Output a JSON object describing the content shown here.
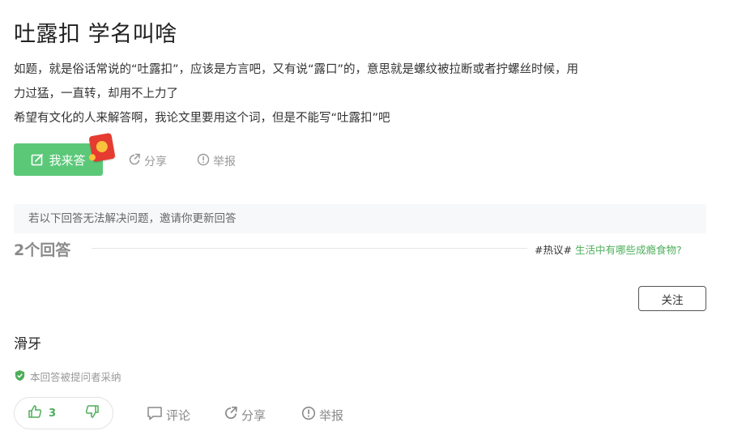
{
  "question": {
    "title": "吐露扣 学名叫啥",
    "description_lines": [
      "如题，就是俗话常说的“吐露扣”，应该是方言吧，又有说“露口”的，意思就是螺纹被拉断或者拧螺丝时候，用",
      "力过猛，一直转，却用不上力了",
      "希望有文化的人来解答啊，我论文里要用这个词，但是不能写“吐露扣”吧"
    ]
  },
  "actions": {
    "answer_label": "我来答",
    "share_label": "分享",
    "report_label": "举报"
  },
  "notice": "若以下回答无法解决问题，邀请你更新回答",
  "answers_header": {
    "count_label": "2个回答",
    "hot_tag": "#热议#",
    "hot_link": "生活中有哪些成瘾食物?"
  },
  "answer": {
    "follow_label": "关注",
    "text": "滑牙",
    "accepted_label": "本回答被提问者采纳",
    "upvotes": "3",
    "comment_label": "评论",
    "share_label": "分享",
    "report_label": "举报"
  },
  "colors": {
    "accent_green": "#5bc878",
    "link_green": "#4dae5a",
    "redpacket": "#e63b30"
  },
  "icons": [
    "edit-icon",
    "redpacket-icon",
    "share-icon",
    "report-icon",
    "shield-check-icon",
    "thumbs-up-icon",
    "thumbs-down-icon",
    "comment-icon"
  ]
}
